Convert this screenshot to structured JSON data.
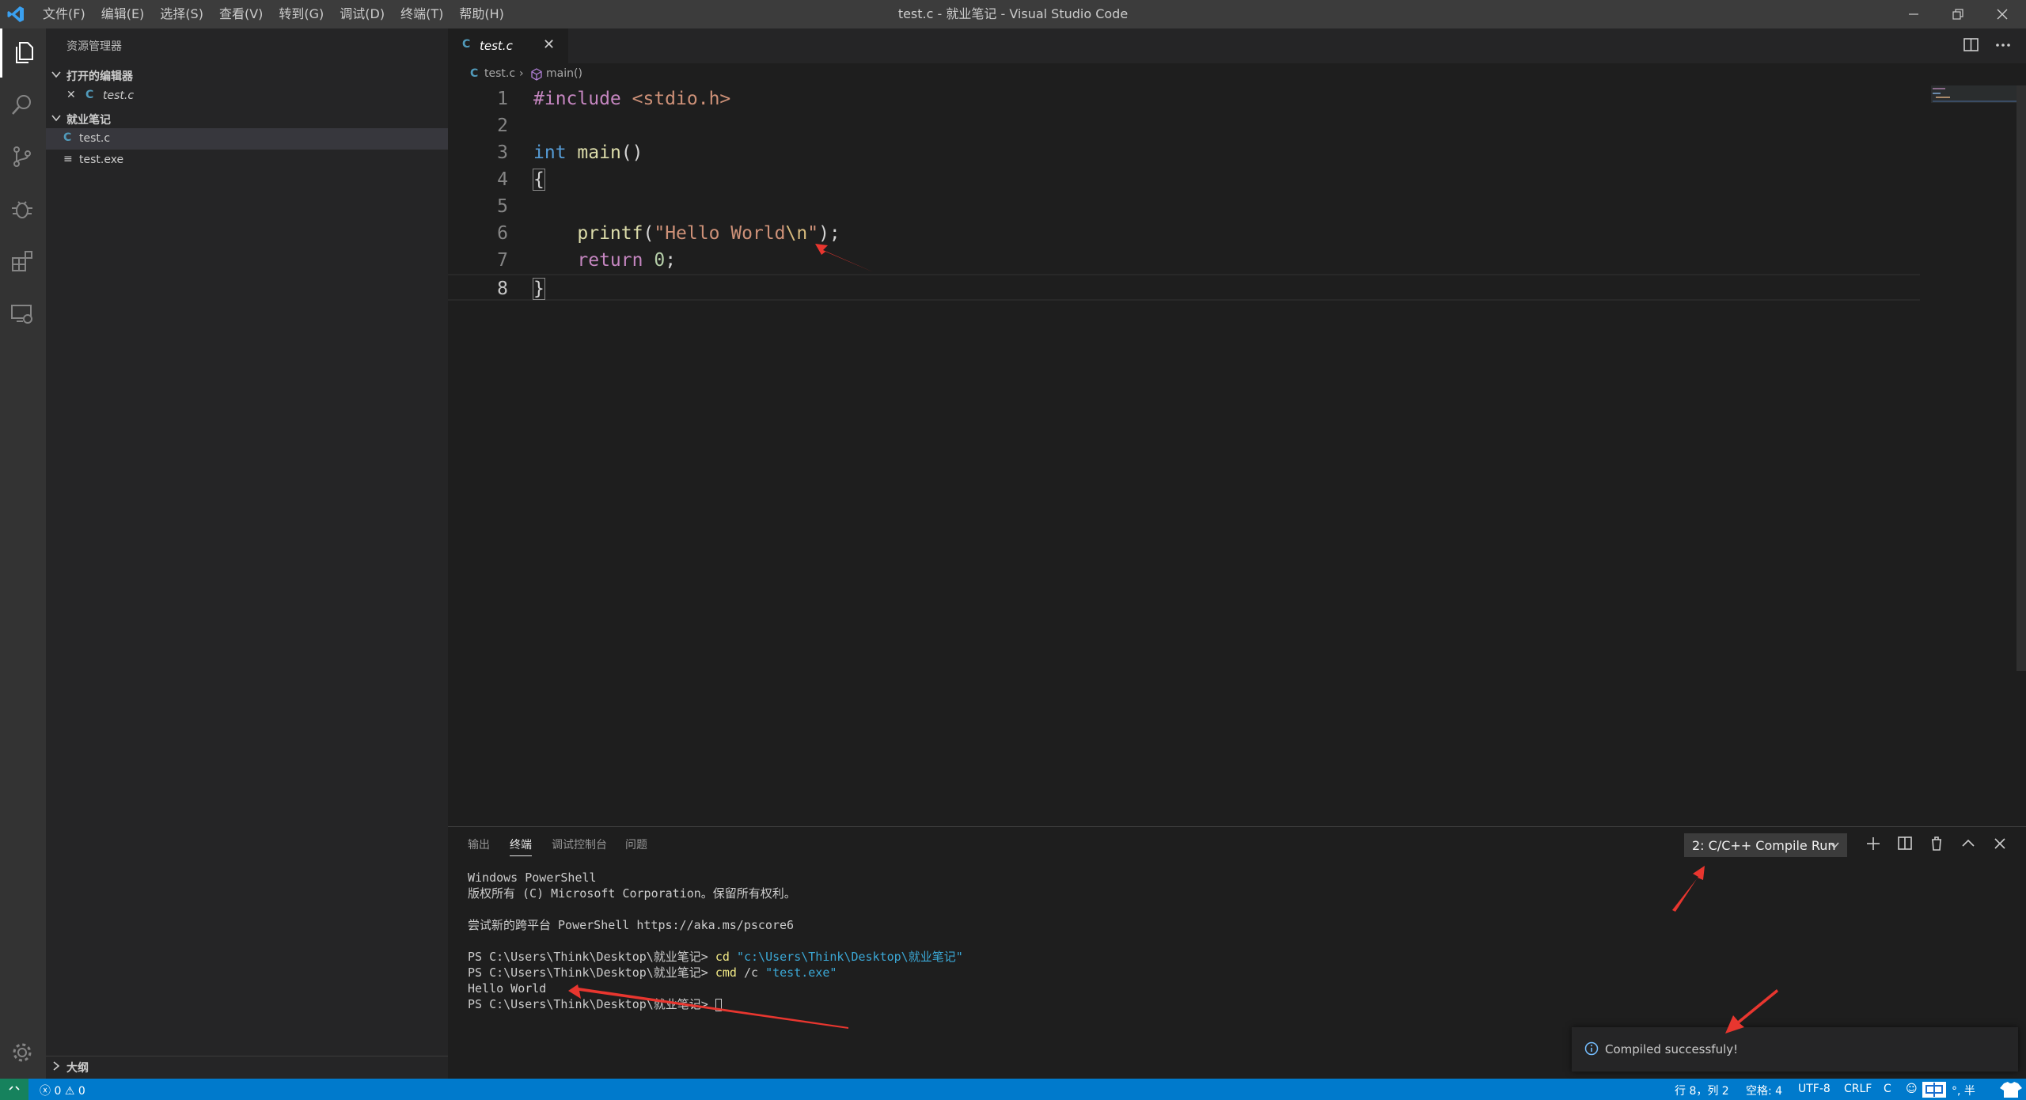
{
  "window": {
    "title": "test.c - 就业笔记 - Visual Studio Code",
    "menu": [
      "文件(F)",
      "编辑(E)",
      "选择(S)",
      "查看(V)",
      "转到(G)",
      "调试(D)",
      "终端(T)",
      "帮助(H)"
    ]
  },
  "sidebar": {
    "title": "资源管理器",
    "open_editors": {
      "header": "打开的编辑器",
      "items": [
        {
          "icon": "C",
          "name": "test.c"
        }
      ]
    },
    "folder": {
      "header": "就业笔记",
      "items": [
        {
          "icon": "C",
          "name": "test.c"
        },
        {
          "icon": "≡",
          "name": "test.exe"
        }
      ]
    },
    "outline_header": "大纲"
  },
  "tabs": [
    {
      "icon": "C",
      "label": "test.c"
    }
  ],
  "breadcrumb": {
    "file": "test.c",
    "symbol": "main()"
  },
  "editor": {
    "line_numbers": [
      "1",
      "2",
      "3",
      "4",
      "5",
      "6",
      "7",
      "8"
    ],
    "current_line": 8
  },
  "panel": {
    "tabs": [
      "输出",
      "终端",
      "调试控制台",
      "问题"
    ],
    "active_tab": "终端",
    "terminal_selector": "2: C/C++ Compile Run",
    "terminal_lines": [
      "Windows PowerShell",
      "版权所有 (C) Microsoft Corporation。保留所有权利。",
      "",
      "尝试新的跨平台 PowerShell https://aka.ms/pscore6",
      "",
      "PS C:\\Users\\Think\\Desktop\\就业笔记> ",
      "PS C:\\Users\\Think\\Desktop\\就业笔记> ",
      "Hello World",
      "PS C:\\Users\\Think\\Desktop\\就业笔记> "
    ],
    "terminal_cmd1": {
      "cmd": "cd",
      "arg": "\"c:\\Users\\Think\\Desktop\\就业笔记\""
    },
    "terminal_cmd2": {
      "cmd": "cmd",
      "flag": " /c ",
      "arg": "\"test.exe\""
    }
  },
  "notification": {
    "message": "Compiled successfuly!"
  },
  "statusbar": {
    "errors": "0",
    "warnings": "0",
    "position": "行 8，列 2",
    "spaces": "空格: 4",
    "encoding": "UTF-8",
    "eol": "CRLF",
    "language": "C",
    "ime": "°, 半"
  },
  "colors": {
    "accent": "#007acc",
    "annotation_arrow": "#e8362f",
    "activity_bar": "#333333",
    "sidebar": "#252526",
    "editor": "#1e1e1e"
  }
}
